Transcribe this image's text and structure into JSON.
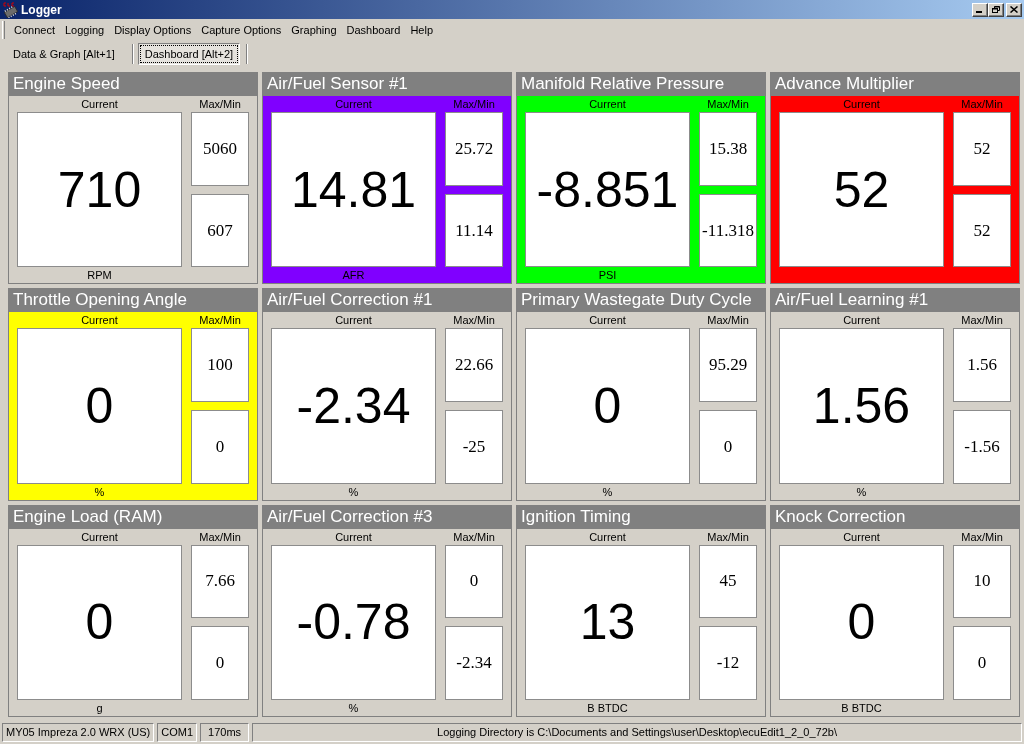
{
  "window": {
    "title": "Logger"
  },
  "menu": [
    {
      "label": "Connect"
    },
    {
      "label": "Logging"
    },
    {
      "label": "Display Options"
    },
    {
      "label": "Capture Options"
    },
    {
      "label": "Graphing"
    },
    {
      "label": "Dashboard"
    },
    {
      "label": "Help"
    }
  ],
  "tabs": [
    {
      "label": "Data & Graph [Alt+1]",
      "selected": false
    },
    {
      "label": "Dashboard [Alt+2]",
      "selected": true
    }
  ],
  "gauges": [
    {
      "title": "Engine Speed",
      "current_label": "Current",
      "range_label": "Max/Min",
      "current": "710",
      "max": "5060",
      "min": "607",
      "unit": "RPM"
    },
    {
      "title": "Air/Fuel Sensor #1",
      "color": "#8000ff",
      "current_label": "Current",
      "range_label": "Max/Min",
      "current": "14.81",
      "max": "25.72",
      "min": "11.14",
      "unit": "AFR"
    },
    {
      "title": "Manifold Relative Pressure",
      "color": "#00ff00",
      "current_label": "Current",
      "range_label": "Max/Min",
      "current": "-8.851",
      "max": "15.38",
      "min": "-11.318",
      "unit": "PSI"
    },
    {
      "title": "Advance Multiplier",
      "color": "#ff0000",
      "current_label": "Current",
      "range_label": "Max/Min",
      "current": "52",
      "max": "52",
      "min": "52"
    },
    {
      "title": "Throttle Opening Angle",
      "color": "#ffff00",
      "current_label": "Current",
      "range_label": "Max/Min",
      "current": "0",
      "max": "100",
      "min": "0",
      "unit": "%"
    },
    {
      "title": "Air/Fuel Correction #1",
      "current_label": "Current",
      "range_label": "Max/Min",
      "current": "-2.34",
      "max": "22.66",
      "min": "-25",
      "unit": "%"
    },
    {
      "title": "Primary Wastegate Duty Cycle",
      "current_label": "Current",
      "range_label": "Max/Min",
      "current": "0",
      "max": "95.29",
      "min": "0",
      "unit": "%"
    },
    {
      "title": "Air/Fuel Learning #1",
      "current_label": "Current",
      "range_label": "Max/Min",
      "current": "1.56",
      "max": "1.56",
      "min": "-1.56",
      "unit": "%"
    },
    {
      "title": "Engine Load (RAM)",
      "current_label": "Current",
      "range_label": "Max/Min",
      "current": "0",
      "max": "7.66",
      "min": "0",
      "unit": "g"
    },
    {
      "title": "Air/Fuel Correction #3",
      "current_label": "Current",
      "range_label": "Max/Min",
      "current": "-0.78",
      "max": "0",
      "min": "-2.34",
      "unit": "%"
    },
    {
      "title": "Ignition Timing",
      "current_label": "Current",
      "range_label": "Max/Min",
      "current": "13",
      "max": "45",
      "min": "-12",
      "unit": "B BTDC"
    },
    {
      "title": "Knock Correction",
      "current_label": "Current",
      "range_label": "Max/Min",
      "current": "0",
      "max": "10",
      "min": "0",
      "unit": "B BTDC"
    }
  ],
  "status_bar": {
    "vehicle": "MY05 Impreza 2.0 WRX (US)",
    "port": "COM1",
    "interval": "170ms",
    "message": "Logging Directory is C:\\Documents and Settings\\user\\Desktop\\ecuEdit1_2_0_72b\\"
  }
}
